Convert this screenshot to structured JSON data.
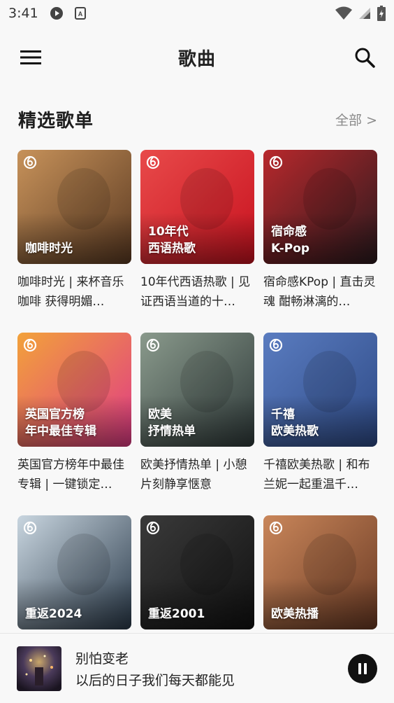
{
  "status_bar": {
    "time": "3:41",
    "icons": [
      "play-notification-icon",
      "font-notification-icon",
      "wifi-icon",
      "signal-icon",
      "battery-icon"
    ]
  },
  "app_bar": {
    "title": "歌曲",
    "menu_icon": "menu-icon",
    "search_icon": "search-icon"
  },
  "section": {
    "title": "精选歌单",
    "see_all": "全部 >"
  },
  "playlists": [
    {
      "cover_text": "咖啡时光",
      "caption": "咖啡时光 | 来杯音乐咖啡 获得明媚…",
      "colors": [
        "#5b3a22",
        "#c7925a"
      ]
    },
    {
      "cover_text": "10年代\n西语热歌",
      "caption": "10年代西语热歌 | 见证西语当道的十…",
      "colors": [
        "#c8121f",
        "#e84a4a"
      ]
    },
    {
      "cover_text": "宿命感\nK-Pop",
      "caption": "宿命感KPop | 直击灵魂 酣畅淋漓的…",
      "colors": [
        "#2a1a1e",
        "#b8282c"
      ]
    },
    {
      "cover_text": "英国官方榜\n年中最佳专辑",
      "caption": "英国官方榜年中最佳专辑 | 一键锁定…",
      "colors": [
        "#e03a86",
        "#f2a23a"
      ]
    },
    {
      "cover_text": "欧美\n抒情热单",
      "caption": "欧美抒情热单 | 小憩片刻静享惬意",
      "colors": [
        "#2f3a3a",
        "#8a9a8c"
      ]
    },
    {
      "cover_text": "千禧\n欧美热歌",
      "caption": "千禧欧美热歌 | 和布兰妮一起重温千…",
      "colors": [
        "#2e4a86",
        "#5a7cc0"
      ]
    },
    {
      "cover_text": "重返2024",
      "caption": "",
      "colors": [
        "#2a3a4a",
        "#c9d6e0"
      ]
    },
    {
      "cover_text": "重返2001",
      "caption": "",
      "colors": [
        "#111111",
        "#3a3a3a"
      ]
    },
    {
      "cover_text": "欧美热播",
      "caption": "",
      "colors": [
        "#6a3a24",
        "#c9865a"
      ]
    }
  ],
  "mini_player": {
    "title": "别怕变老",
    "subtitle": "以后的日子我们每天都能见",
    "pause_icon": "pause-icon"
  }
}
